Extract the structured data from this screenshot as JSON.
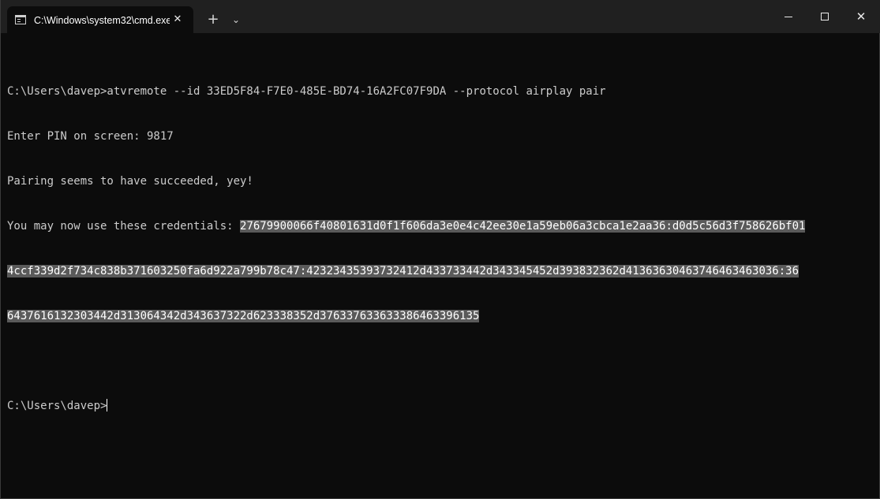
{
  "tab": {
    "title": "C:\\Windows\\system32\\cmd.exe",
    "close_glyph": "✕",
    "new_tab_glyph": "+",
    "dropdown_glyph": "⌄"
  },
  "window_controls": {
    "close_glyph": "✕"
  },
  "terminal": {
    "command_line": "C:\\Users\\davep>atvremote --id 33ED5F84-F7E0-485E-BD74-16A2FC07F9DA --protocol airplay pair",
    "pin_line": "Enter PIN on screen: 9817",
    "success_line": "Pairing seems to have succeeded, yey!",
    "credentials_prefix": "You may now use these credentials: ",
    "credentials_part1": "27679900066f40801631d0f1f606da3e0e4c42ee30e1a59eb06a3cbca1e2aa36:d0d5c56d3f758626bf01",
    "credentials_part2": "4ccf339d2f734c838b371603250fa6d922a799b78c47:42323435393732412d433733442d343345452d393832362d41363630463746463463036:36",
    "credentials_part3": "6437616132303442d313064342d343637322d623338352d376337633633386463396135",
    "prompt": "C:\\Users\\davep>"
  },
  "colors": {
    "background": "#0c0c0c",
    "titlebar": "#202020",
    "text": "#cccccc",
    "selection": "#5a5a5a"
  },
  "icons": [
    "cmd-icon",
    "close-icon",
    "plus-icon",
    "chevron-down-icon",
    "minimize-icon",
    "maximize-icon",
    "window-close-icon"
  ]
}
